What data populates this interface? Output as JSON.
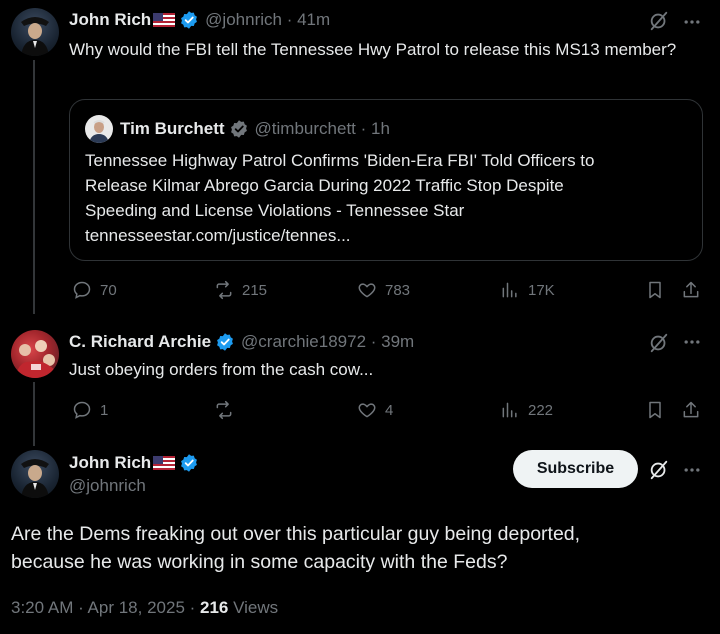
{
  "tweet1": {
    "name": "John Rich",
    "handle": "@johnrich",
    "time": "41m",
    "text": "Why would the FBI tell the Tennessee Hwy Patrol to release this MS13 member?",
    "quote": {
      "name": "Tim Burchett",
      "handle": "@timburchett",
      "time": "1h",
      "lines": [
        "Tennessee Highway Patrol Confirms 'Biden-Era FBI' Told Officers to",
        "Release Kilmar Abrego Garcia During 2022 Traffic Stop Despite",
        "Speeding and License Violations - Tennessee Star",
        "tennesseestar.com/justice/tennes..."
      ]
    },
    "actions": {
      "replies": "70",
      "reposts": "215",
      "likes": "783",
      "views": "17K"
    }
  },
  "tweet2": {
    "name": "C. Richard Archie",
    "handle": "@crarchie18972",
    "time": "39m",
    "text": "Just obeying orders from the cash cow...",
    "actions": {
      "replies": "1",
      "reposts": "",
      "likes": "4",
      "views": "222"
    }
  },
  "main": {
    "name": "John Rich",
    "handle": "@johnrich",
    "subscribe_label": "Subscribe",
    "text_lines": [
      "Are the Dems freaking out over this particular guy being deported,",
      "because he was working in some capacity with the Feds?"
    ],
    "timestamp": "3:20 AM · Apr 18, 2025 · ",
    "views_count": "216",
    "views_label": " Views"
  },
  "colors": {
    "accent": "#1d9bf0",
    "muted": "#71767b",
    "text": "#e7e9ea",
    "bg": "#000000"
  },
  "icons": [
    "verified-badge-icon",
    "us-flag-icon",
    "grok-icon",
    "more-icon",
    "reply-icon",
    "repost-icon",
    "like-icon",
    "views-icon",
    "bookmark-icon",
    "share-icon"
  ]
}
